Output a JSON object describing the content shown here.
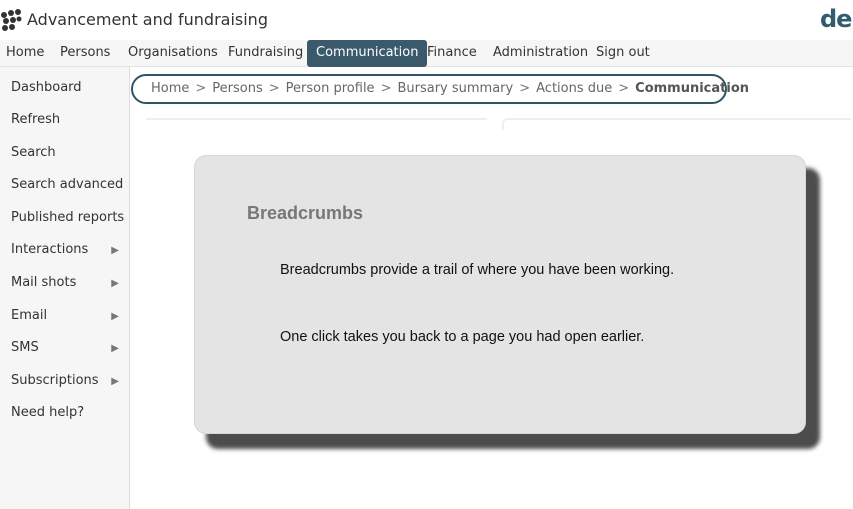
{
  "app": {
    "title": "Advancement and fundraising",
    "brand": "de"
  },
  "topnav": {
    "items": [
      {
        "label": "Home"
      },
      {
        "label": "Persons"
      },
      {
        "label": "Organisations"
      },
      {
        "label": "Fundraising"
      },
      {
        "label": "Communication",
        "active": true
      },
      {
        "label": "Finance"
      },
      {
        "label": "Administration"
      },
      {
        "label": "Sign out"
      }
    ]
  },
  "sidebar": {
    "items": [
      {
        "label": "Dashboard"
      },
      {
        "label": "Refresh"
      },
      {
        "label": "Search"
      },
      {
        "label": "Search advanced"
      },
      {
        "label": "Published reports"
      },
      {
        "label": "Interactions",
        "arrow": "▶"
      },
      {
        "label": "Mail shots",
        "arrow": "▶"
      },
      {
        "label": "Email",
        "arrow": "▶"
      },
      {
        "label": "SMS",
        "arrow": "▶"
      },
      {
        "label": "Subscriptions",
        "arrow": "▶"
      },
      {
        "label": "Need help?"
      }
    ]
  },
  "breadcrumb": {
    "separator": ">",
    "items": [
      "Home",
      "Persons",
      "Person profile",
      "Bursary summary",
      "Actions due",
      "Communication"
    ]
  },
  "callout": {
    "title": "Breadcrumbs",
    "line1": "Breadcrumbs provide a trail of where you have been working.",
    "line2": "One click takes you back to a page you had open earlier."
  },
  "colors": {
    "accent": "#3a5a6b",
    "breadcrumb_border": "#2e5466",
    "callout_bg": "#e4e4e4"
  }
}
